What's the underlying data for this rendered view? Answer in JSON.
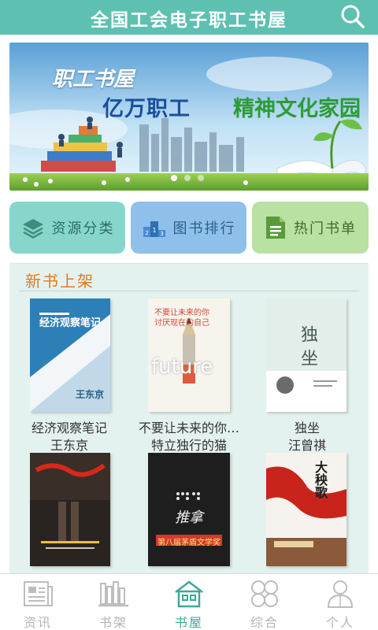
{
  "header": {
    "title": "全国工会电子职工书屋",
    "search_icon": "search-icon"
  },
  "banner": {
    "title": "职工书屋",
    "slogan_blue": "亿万职工",
    "slogan_green": "精神文化家园",
    "slides": 3,
    "active_slide": 1
  },
  "quick_links": [
    {
      "label": "资源分类",
      "icon": "layers-icon",
      "color": "#86d6cb"
    },
    {
      "label": "图书排行",
      "icon": "podium-icon",
      "color": "#8fc0ea"
    },
    {
      "label": "热门书单",
      "icon": "document-list-icon",
      "color": "#b8e1a2"
    }
  ],
  "section": {
    "title": "新书上架",
    "books": [
      {
        "name": "经济观察笔记",
        "author": "王东京",
        "cover_title": "经济观察笔记",
        "cover_author": "王东京"
      },
      {
        "name": "不要让未来的你…",
        "author": "特立独行的猫",
        "cover_title": "不要让未来的你讨厌现在的自己",
        "cover_word": "future"
      },
      {
        "name": "独坐",
        "author": "汪曾祺",
        "cover_title": "独坐"
      },
      {
        "name": "",
        "author": "",
        "cover_title": ""
      },
      {
        "name": "",
        "author": "",
        "cover_title": "推拿",
        "cover_badge": "第八届茅盾文学奖"
      },
      {
        "name": "",
        "author": "",
        "cover_title": "大秧歌"
      }
    ]
  },
  "tabbar": {
    "active": "书屋",
    "items": [
      {
        "label": "资讯",
        "icon": "news-icon"
      },
      {
        "label": "书架",
        "icon": "bookshelf-icon"
      },
      {
        "label": "书屋",
        "icon": "house-icon"
      },
      {
        "label": "综合",
        "icon": "grid-circles-icon"
      },
      {
        "label": "个人",
        "icon": "person-icon"
      }
    ]
  }
}
